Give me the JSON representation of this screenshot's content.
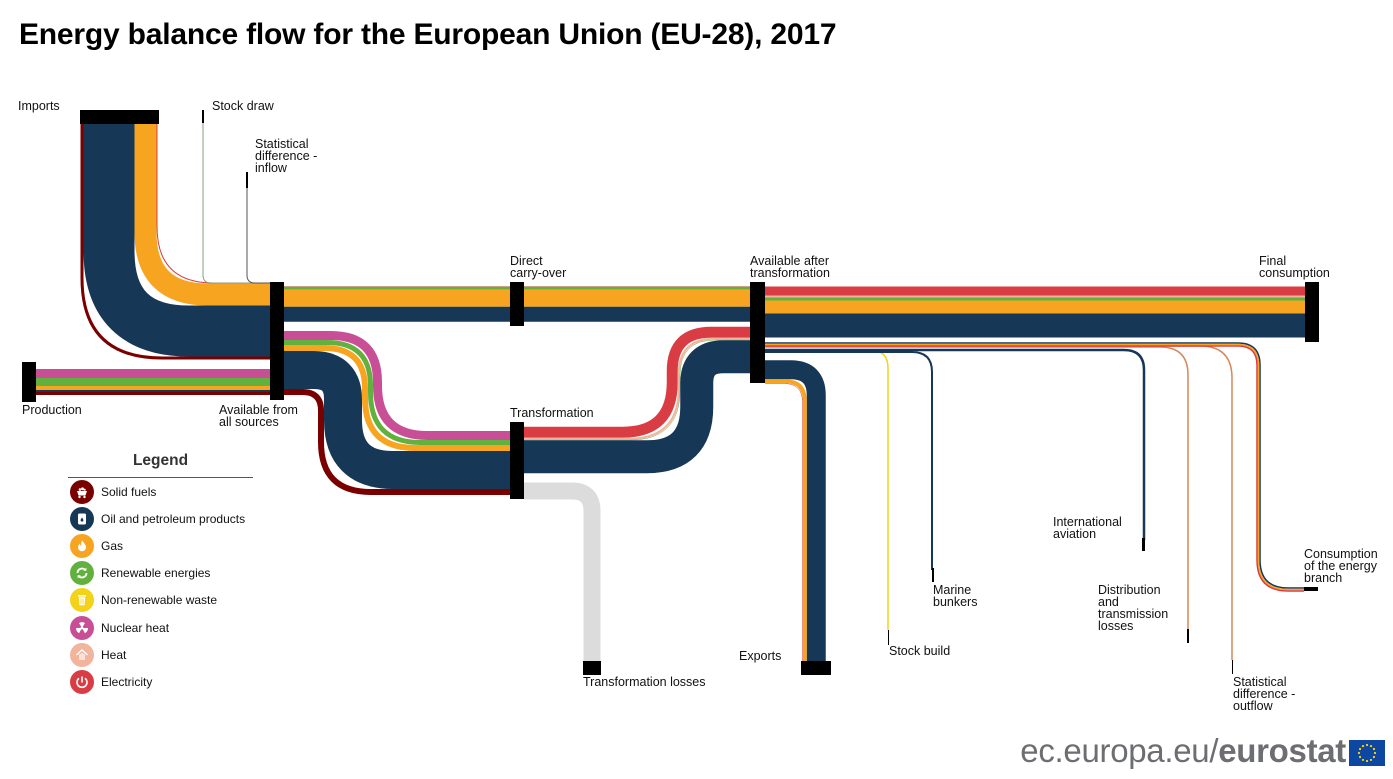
{
  "title": "Energy balance flow for the European Union (EU-28), 2017",
  "colors": {
    "solid_fuels": "#7a0000",
    "oil": "#173757",
    "gas": "#f7a520",
    "renewables": "#62b13e",
    "waste": "#f3d21a",
    "nuclear": "#c84f96",
    "heat": "#f2b49c",
    "electricity": "#d93d43",
    "losses": "#dcdcdc",
    "node": "#000000"
  },
  "nodes": [
    {
      "id": "imports",
      "label": "Imports"
    },
    {
      "id": "stock_draw",
      "label": "Stock draw"
    },
    {
      "id": "stat_diff_in",
      "label": "Statistical\ndifference -\ninflow"
    },
    {
      "id": "production",
      "label": "Production"
    },
    {
      "id": "available_all",
      "label": "Available from\nall sources"
    },
    {
      "id": "direct_carry",
      "label": "Direct\ncarry-over"
    },
    {
      "id": "transformation",
      "label": "Transformation"
    },
    {
      "id": "available_after",
      "label": "Available after\ntransformation"
    },
    {
      "id": "final_consumption",
      "label": "Final\nconsumption"
    },
    {
      "id": "transformation_losses",
      "label": "Transformation losses"
    },
    {
      "id": "exports",
      "label": "Exports"
    },
    {
      "id": "stock_build",
      "label": "Stock build"
    },
    {
      "id": "marine_bunkers",
      "label": "Marine\nbunkers"
    },
    {
      "id": "intl_aviation",
      "label": "International\naviation"
    },
    {
      "id": "distribution_losses",
      "label": "Distribution\nand\ntransmission\nlosses"
    },
    {
      "id": "stat_diff_out",
      "label": "Statistical\ndifference -\noutflow"
    },
    {
      "id": "energy_branch",
      "label": "Consumption\nof the energy\nbranch"
    }
  ],
  "flows": [
    {
      "from": "imports",
      "to": "available_all",
      "shares": {
        "solid_fuels": 3,
        "oil": 51,
        "gas": 22,
        "electricity": 1
      }
    },
    {
      "from": "stock_draw",
      "to": "available_all",
      "shares": {
        "oil": 0.5
      }
    },
    {
      "from": "stat_diff_in",
      "to": "available_all",
      "shares": {
        "oil": 0.3
      }
    },
    {
      "from": "production",
      "to": "available_all",
      "shares": {
        "solid_fuels": 3,
        "oil": 2,
        "gas": 4,
        "renewables": 8,
        "nuclear": 9
      }
    },
    {
      "from": "available_all",
      "to": "direct_carry",
      "shares": {
        "oil": 15,
        "gas": 17,
        "renewables": 3,
        "electricity": 0.5
      }
    },
    {
      "from": "available_all",
      "to": "transformation",
      "shares": {
        "solid_fuels": 6,
        "oil": 38,
        "gas": 6,
        "renewables": 5,
        "nuclear": 9
      }
    },
    {
      "from": "transformation",
      "to": "available_after",
      "shares": {
        "oil": 33,
        "heat": 2,
        "renewables": 0.5,
        "electricity": 11
      }
    },
    {
      "from": "transformation",
      "to": "transformation_losses",
      "shares": {
        "losses": 17
      }
    },
    {
      "from": "direct_carry",
      "to": "available_after",
      "shares": {
        "oil": 15,
        "gas": 17,
        "renewables": 3,
        "electricity": 0.5
      }
    },
    {
      "from": "available_after",
      "to": "final_consumption",
      "shares": {
        "oil": 24,
        "gas": 13,
        "renewables": 3,
        "heat": 2,
        "electricity": 9
      }
    },
    {
      "from": "available_after",
      "to": "exports",
      "shares": {
        "oil": 19,
        "gas": 4,
        "electricity": 0.5
      }
    },
    {
      "from": "available_after",
      "to": "stock_build",
      "shares": {
        "waste": 0.5
      }
    },
    {
      "from": "available_after",
      "to": "marine_bunkers",
      "shares": {
        "oil": 1.5
      }
    },
    {
      "from": "available_after",
      "to": "intl_aviation",
      "shares": {
        "oil": 1.8
      }
    },
    {
      "from": "available_after",
      "to": "distribution_losses",
      "shares": {
        "heat": 1
      }
    },
    {
      "from": "available_after",
      "to": "stat_diff_out",
      "shares": {
        "heat": 1
      }
    },
    {
      "from": "available_after",
      "to": "energy_branch",
      "shares": {
        "oil": 1,
        "gas": 1,
        "electricity": 1
      }
    }
  ],
  "legend": {
    "title": "Legend",
    "items": [
      {
        "key": "solid_fuels",
        "label": "Solid fuels",
        "icon": "mine-cart-icon"
      },
      {
        "key": "oil",
        "label": "Oil and petroleum products",
        "icon": "oil-barrel-icon"
      },
      {
        "key": "gas",
        "label": "Gas",
        "icon": "flame-icon"
      },
      {
        "key": "renewables",
        "label": "Renewable energies",
        "icon": "recycle-arrows-icon"
      },
      {
        "key": "waste",
        "label": "Non-renewable waste",
        "icon": "trash-bin-icon"
      },
      {
        "key": "nuclear",
        "label": "Nuclear heat",
        "icon": "radiation-icon"
      },
      {
        "key": "heat",
        "label": "Heat",
        "icon": "heat-house-icon"
      },
      {
        "key": "electricity",
        "label": "Electricity",
        "icon": "power-plug-icon"
      }
    ]
  },
  "footer": {
    "site_prefix": "ec.europa.eu/",
    "site_brand": "eurostat"
  }
}
